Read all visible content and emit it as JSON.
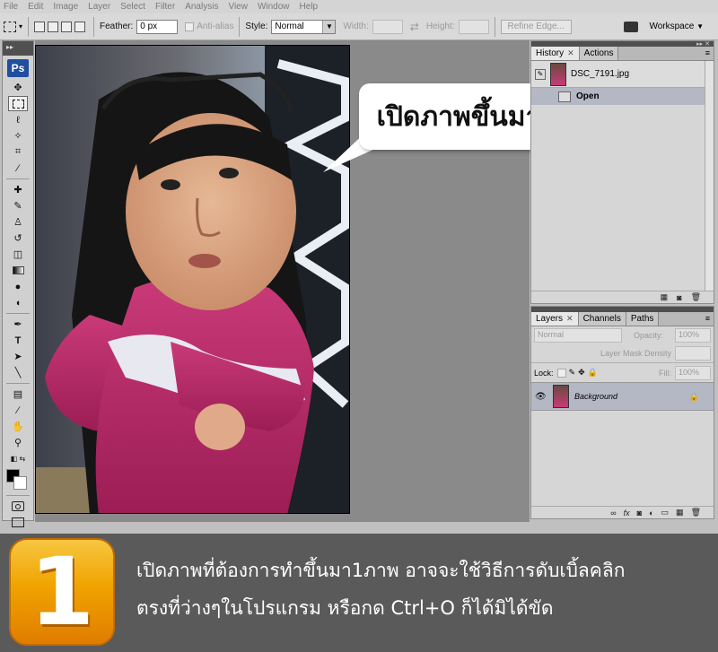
{
  "menubar": [
    "File",
    "Edit",
    "Image",
    "Layer",
    "Select",
    "Filter",
    "Analysis",
    "View",
    "Window",
    "Help"
  ],
  "options": {
    "feather_label": "Feather:",
    "feather_value": "0 px",
    "antialias_label": "Anti-alias",
    "style_label": "Style:",
    "style_value": "Normal",
    "width_label": "Width:",
    "height_label": "Height:",
    "refine_label": "Refine Edge...",
    "workspace_label": "Workspace"
  },
  "toolbox": {
    "logo": "Ps"
  },
  "history": {
    "tabs": [
      "History",
      "Actions"
    ],
    "snapshot_name": "DSC_7191.jpg",
    "states": [
      "Open"
    ]
  },
  "layers": {
    "tabs": [
      "Layers",
      "Channels",
      "Paths"
    ],
    "blend_mode": "Normal",
    "opacity_label": "Opacity:",
    "opacity_value": "100%",
    "mask_density_label": "Layer Mask Density",
    "lock_label": "Lock:",
    "fill_label": "Fill:",
    "fill_value": "100%",
    "layer_name": "Background"
  },
  "bubble": {
    "text": "เปิดภาพขึ้นมา"
  },
  "banner": {
    "step": "1",
    "line1": "เปิดภาพที่ต้องการทำขึ้นมา1ภาพ อาจจะใช้วิธีการดับเบิ้ลคลิก",
    "line2": "ตรงที่ว่างๆในโปรแกรม หรือกด Ctrl+O ก็ได้มิได้ขัด"
  },
  "colors": {
    "accent": "#1f4f9e",
    "banner_bg": "#5a5a5a",
    "badge": "#f0a300",
    "history_selected": "#b4b8c4"
  }
}
